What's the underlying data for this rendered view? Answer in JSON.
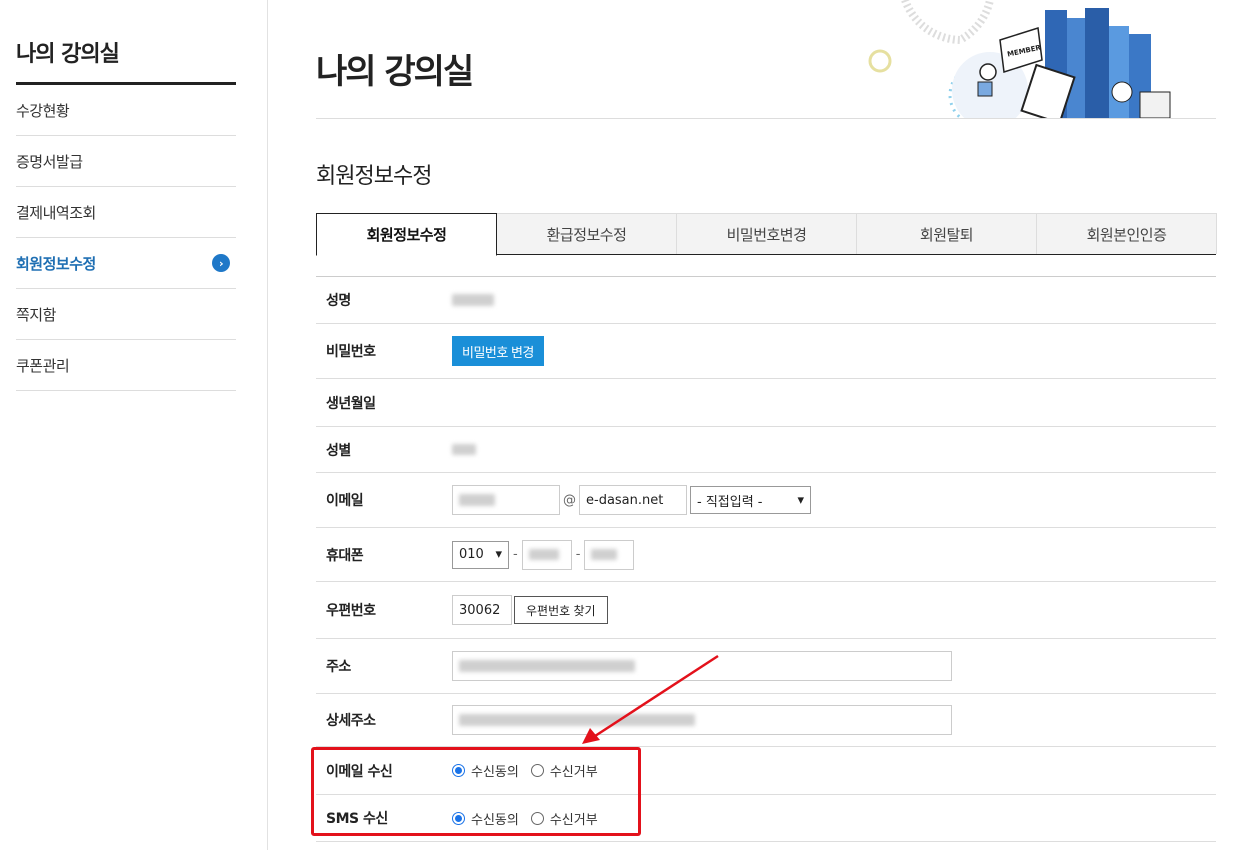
{
  "sidebar": {
    "title": "나의 강의실",
    "items": [
      {
        "label": "수강현황"
      },
      {
        "label": "증명서발급"
      },
      {
        "label": "결제내역조회"
      },
      {
        "label": "회원정보수정",
        "active": true
      },
      {
        "label": "쪽지함"
      },
      {
        "label": "쿠폰관리"
      }
    ],
    "active_arrow": "›"
  },
  "header": {
    "title": "나의 강의실",
    "illustration_text": "MEMBER"
  },
  "section": {
    "title": "회원정보수정"
  },
  "tabs": [
    {
      "label": "회원정보수정",
      "active": true
    },
    {
      "label": "환급정보수정"
    },
    {
      "label": "비밀번호변경"
    },
    {
      "label": "회원탈퇴"
    },
    {
      "label": "회원본인인증"
    }
  ],
  "form": {
    "name_label": "성명",
    "password_label": "비밀번호",
    "password_button": "비밀번호 변경",
    "birth_label": "생년월일",
    "gender_label": "성별",
    "email_label": "이메일",
    "email_at": "@",
    "email_domain": "e-dasan.net",
    "email_select": "- 직접입력 -",
    "phone_label": "휴대폰",
    "phone_prefix": "010",
    "phone_sep": "-",
    "zip_label": "우편번호",
    "zip_value": "30062",
    "zip_button": "우편번호 찾기",
    "address_label": "주소",
    "detail_address_label": "상세주소",
    "email_receive_label": "이메일 수신",
    "sms_receive_label": "SMS 수신",
    "agree_label": "수신동의",
    "refuse_label": "수신거부"
  },
  "colors": {
    "accent": "#1a8fd8",
    "active_menu": "#1f6fb3",
    "highlight": "#e3111b"
  }
}
